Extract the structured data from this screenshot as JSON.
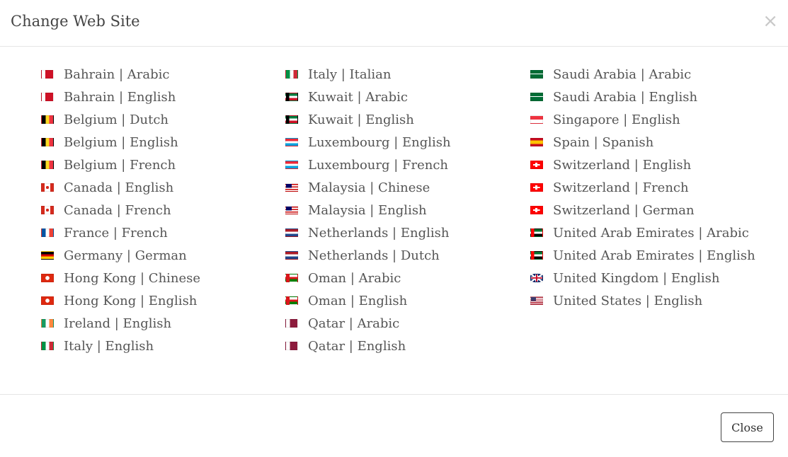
{
  "dialog": {
    "title": "Change Web Site",
    "close_icon": "×",
    "close_button_label": "Close"
  },
  "columns": [
    [
      {
        "label": "Bahrain | Arabic",
        "flag": "bahrain-flag-icon"
      },
      {
        "label": "Bahrain | English",
        "flag": "bahrain-flag-icon"
      },
      {
        "label": "Belgium | Dutch",
        "flag": "belgium-flag-icon"
      },
      {
        "label": "Belgium | English",
        "flag": "belgium-flag-icon"
      },
      {
        "label": "Belgium | French",
        "flag": "belgium-flag-icon"
      },
      {
        "label": "Canada | English",
        "flag": "canada-flag-icon"
      },
      {
        "label": "Canada | French",
        "flag": "canada-flag-icon"
      },
      {
        "label": "France | French",
        "flag": "france-flag-icon"
      },
      {
        "label": "Germany | German",
        "flag": "germany-flag-icon"
      },
      {
        "label": "Hong Kong | Chinese",
        "flag": "hong-kong-flag-icon"
      },
      {
        "label": "Hong Kong | English",
        "flag": "hong-kong-flag-icon"
      },
      {
        "label": "Ireland | English",
        "flag": "ireland-flag-icon"
      },
      {
        "label": "Italy | English",
        "flag": "italy-flag-icon"
      }
    ],
    [
      {
        "label": "Italy | Italian",
        "flag": "italy-flag-icon"
      },
      {
        "label": "Kuwait | Arabic",
        "flag": "kuwait-flag-icon"
      },
      {
        "label": "Kuwait | English",
        "flag": "kuwait-flag-icon"
      },
      {
        "label": "Luxembourg | English",
        "flag": "luxembourg-flag-icon"
      },
      {
        "label": "Luxembourg | French",
        "flag": "luxembourg-flag-icon"
      },
      {
        "label": "Malaysia | Chinese",
        "flag": "malaysia-flag-icon"
      },
      {
        "label": "Malaysia | English",
        "flag": "malaysia-flag-icon"
      },
      {
        "label": "Netherlands | English",
        "flag": "netherlands-flag-icon"
      },
      {
        "label": "Netherlands | Dutch",
        "flag": "netherlands-flag-icon"
      },
      {
        "label": "Oman | Arabic",
        "flag": "oman-flag-icon"
      },
      {
        "label": "Oman | English",
        "flag": "oman-flag-icon"
      },
      {
        "label": "Qatar | Arabic",
        "flag": "qatar-flag-icon"
      },
      {
        "label": "Qatar | English",
        "flag": "qatar-flag-icon"
      }
    ],
    [
      {
        "label": "Saudi Arabia | Arabic",
        "flag": "saudi-arabia-flag-icon"
      },
      {
        "label": "Saudi Arabia | English",
        "flag": "saudi-arabia-flag-icon"
      },
      {
        "label": "Singapore | English",
        "flag": "singapore-flag-icon"
      },
      {
        "label": "Spain | Spanish",
        "flag": "spain-flag-icon"
      },
      {
        "label": "Switzerland | English",
        "flag": "switzerland-flag-icon"
      },
      {
        "label": "Switzerland | French",
        "flag": "switzerland-flag-icon"
      },
      {
        "label": "Switzerland | German",
        "flag": "switzerland-flag-icon"
      },
      {
        "label": "United Arab Emirates | Arabic",
        "flag": "uae-flag-icon"
      },
      {
        "label": "United Arab Emirates | English",
        "flag": "uae-flag-icon"
      },
      {
        "label": "United Kingdom | English",
        "flag": "uk-flag-icon"
      },
      {
        "label": "United States | English",
        "flag": "us-flag-icon"
      }
    ]
  ]
}
